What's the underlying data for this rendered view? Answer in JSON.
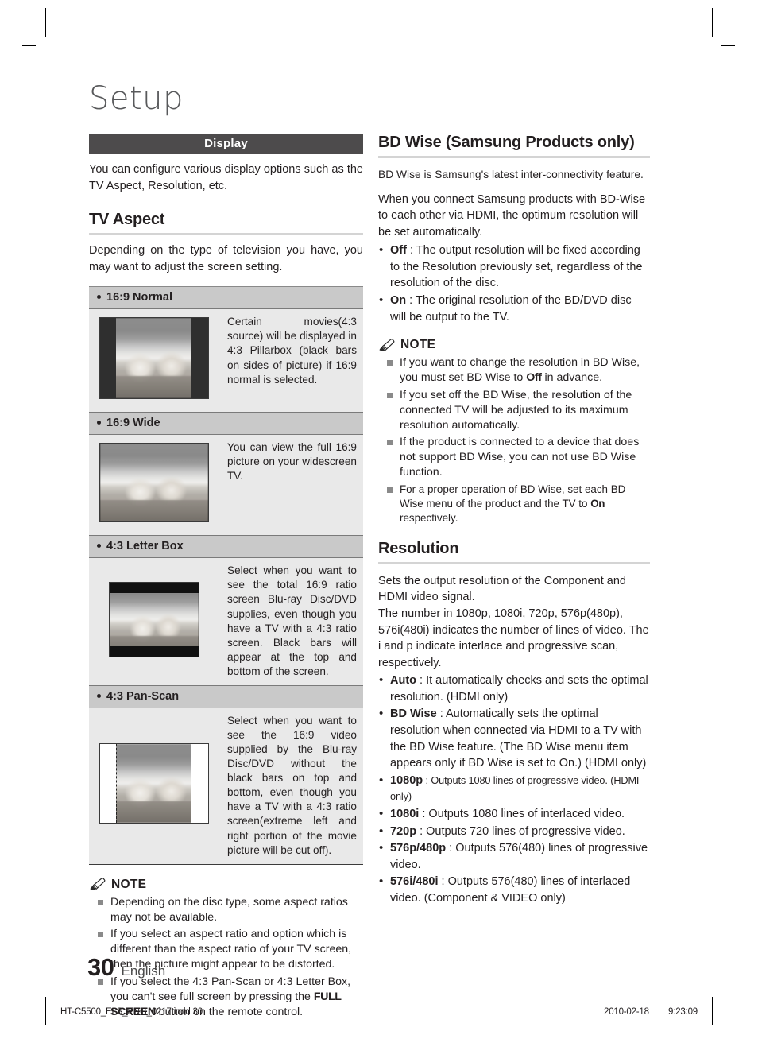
{
  "page": {
    "chapter_title": "Setup",
    "page_number": "30",
    "language": "English"
  },
  "left_column": {
    "section_bar_label": "Display",
    "intro_text": "You can configure various display options such as the TV Aspect, Resolution, etc.",
    "tv_aspect": {
      "heading": "TV Aspect",
      "intro": "Depending on the type of television you have, you may want to adjust the screen setting.",
      "rows": [
        {
          "label": "16:9 Normal",
          "picture_style": "pillarbox",
          "description": "Certain movies(4:3 source) will be displayed in 4:3 Pillarbox (black bars on sides of picture) if 16:9 normal is selected."
        },
        {
          "label": "16:9 Wide",
          "picture_style": "fullwide",
          "description": "You can view the full 16:9 picture on your widescreen TV."
        },
        {
          "label": "4:3 Letter Box",
          "picture_style": "letterbox",
          "description": "Select when you want to see the total 16:9 ratio screen Blu-ray Disc/DVD supplies, even though you have a TV with a 4:3 ratio screen. Black bars will appear at the top and bottom of the screen."
        },
        {
          "label": "4:3 Pan-Scan",
          "picture_style": "panscan",
          "description": "Select when you want to see the 16:9 video supplied by the Blu-ray Disc/DVD without the black bars on top and bottom, even though you have a TV with a 4:3 ratio screen(extreme left and right portion of the movie picture will be cut off)."
        }
      ]
    },
    "note": {
      "label": "NOTE",
      "items": [
        {
          "text": "Depending on the disc type, some aspect ratios may not be available."
        },
        {
          "text": "If you select an aspect ratio and option which is different than the aspect ratio of your TV screen, then the picture might appear to be distorted."
        },
        {
          "pre": "If you select the 4:3 Pan-Scan or 4:3 Letter Box, you can't see full screen by pressing the ",
          "bold": "FULL SCREEN",
          "post": " button on the remote control."
        }
      ]
    }
  },
  "right_column": {
    "bd_wise": {
      "heading": "BD Wise (Samsung Products only)",
      "para1": "BD Wise is Samsung's latest inter-connectivity feature.",
      "para2": "When you connect Samsung products with BD-Wise to each other via HDMI, the optimum resolution will be set automatically.",
      "bullets": [
        {
          "term": "Off",
          "text": " : The output resolution will be fixed according to the Resolution previously set, regardless of the resolution of the disc."
        },
        {
          "term": "On",
          "text": " : The original resolution of the BD/DVD disc will be output to the TV."
        }
      ],
      "note": {
        "label": "NOTE",
        "items": [
          {
            "pre": "If you want to change the resolution in BD Wise, you must set BD Wise to ",
            "bold": "Off",
            "post": " in advance."
          },
          {
            "pre": "If you set off the BD Wise, the resolution of the connected TV will be adjusted to its maximum resolution automatically.",
            "bold": "",
            "post": ""
          },
          {
            "pre": "If the product is connected to a device that does not support BD Wise, you can not use BD Wise function.",
            "bold": "",
            "post": ""
          },
          {
            "pre": "For a proper operation of BD Wise, set each BD Wise menu of the product and the TV to ",
            "bold": "On",
            "post": " respectively."
          }
        ]
      }
    },
    "resolution": {
      "heading": "Resolution",
      "para1": "Sets the output resolution of the Component and HDMI video signal.",
      "para2": "The number in 1080p, 1080i, 720p, 576p(480p), 576i(480i) indicates the number of lines of video. The i and p indicate interlace and progressive scan, respectively.",
      "bullets": [
        {
          "term": "Auto",
          "text": " : It automatically checks and sets the optimal resolution. (HDMI only)",
          "small": false
        },
        {
          "term": "BD Wise",
          "text": " : Automatically sets the optimal resolution when connected via HDMI to a TV with the BD Wise feature. (The BD Wise menu item appears only if BD Wise is set to On.) (HDMI only)",
          "small": false
        },
        {
          "term": "1080p",
          "text": " : Outputs 1080 lines of progressive video. (HDMI only)",
          "small": true
        },
        {
          "term": "1080i",
          "text": " : Outputs 1080 lines of interlaced video.",
          "small": false
        },
        {
          "term": "720p",
          "text": " : Outputs 720 lines of progressive video.",
          "small": false
        },
        {
          "term": "576p/480p",
          "text": " : Outputs 576(480) lines of progressive video.",
          "small": false
        },
        {
          "term": "576i/480i",
          "text": " : Outputs 576(480) lines of interlaced video. (Component & VIDEO only)",
          "small": false
        }
      ]
    }
  },
  "footer": {
    "filename": "HT-C5500_ELS_ENG_0217.indd   30",
    "date": "2010-02-18",
    "time": "9:23:09"
  }
}
